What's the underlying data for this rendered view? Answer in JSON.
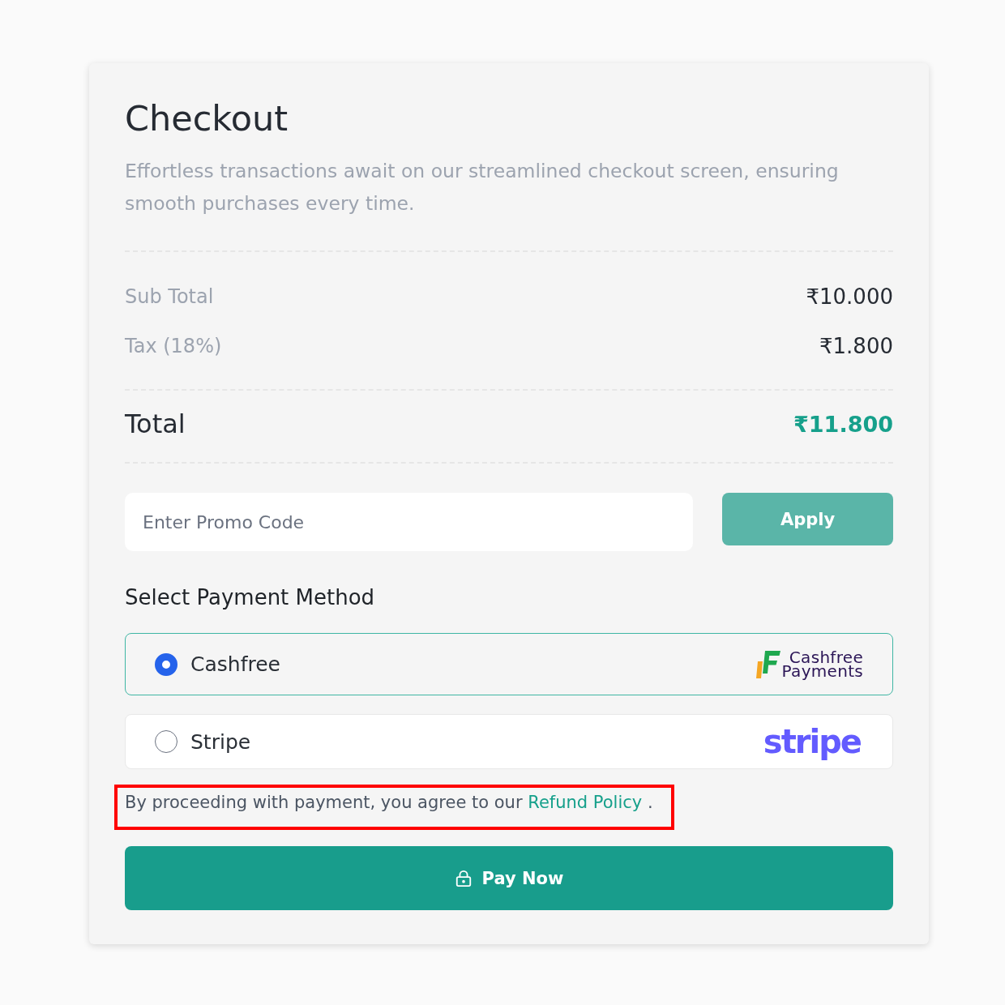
{
  "checkout": {
    "title": "Checkout",
    "subtitle": "Effortless transactions await on our streamlined checkout screen, ensuring smooth purchases every time."
  },
  "summary": {
    "rows": [
      {
        "label": "Sub Total",
        "value": "₹10.000"
      },
      {
        "label": "Tax (18%)",
        "value": "₹1.800"
      }
    ],
    "total": {
      "label": "Total",
      "value": "₹11.800"
    }
  },
  "promo": {
    "placeholder": "Enter Promo Code",
    "button": "Apply"
  },
  "payment": {
    "heading": "Select Payment Method",
    "methods": [
      {
        "label": "Cashfree",
        "selected": true,
        "logo": {
          "kind": "cashfree",
          "lines": [
            "Cashfree",
            "Payments"
          ]
        }
      },
      {
        "label": "Stripe",
        "selected": false,
        "logo": {
          "kind": "stripe",
          "lines": [
            "stripe"
          ]
        }
      }
    ]
  },
  "notice": {
    "text": "By proceeding with payment, you agree to our",
    "link": "Refund Policy",
    "end": ".",
    "highlighted": true
  },
  "pay_button": {
    "label": "Pay Now"
  }
}
